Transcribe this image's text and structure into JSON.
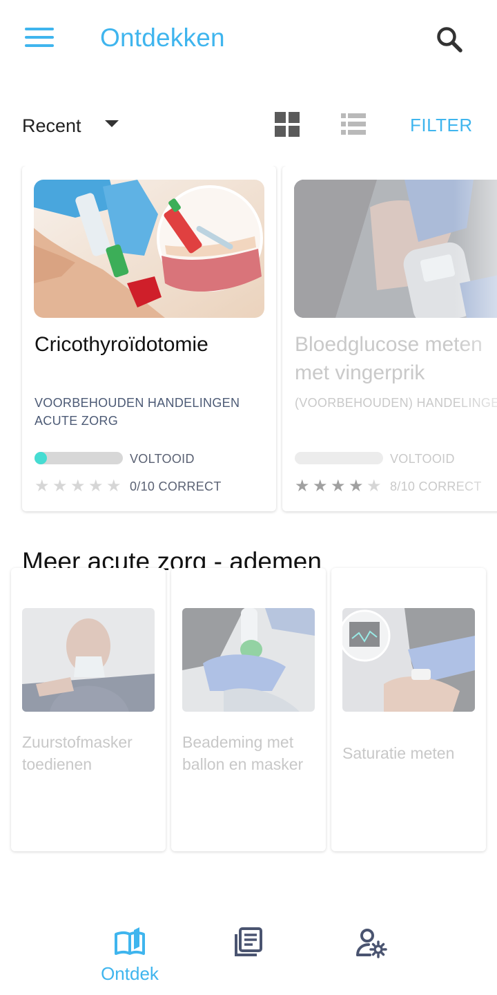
{
  "app_bar": {
    "title": "Ontdekken",
    "menu_icon": "menu-icon",
    "search_icon": "search-icon"
  },
  "toolbar": {
    "sort_value": "Recent",
    "grid_view_icon": "grid-view-icon",
    "list_view_icon": "list-view-icon",
    "filter_label": "FILTER"
  },
  "featured": [
    {
      "title": "Cricothyroïdotomie",
      "category": "VOORBEHOUDEN HANDELINGEN ACUTE ZORG",
      "progress": 0.06,
      "status": "VOLTOOID",
      "stars": 0,
      "score": "0/10 CORRECT"
    },
    {
      "title": "Bloedglucose meten met vingerprik",
      "category": "(VOORBEHOUDEN) HANDELINGEN",
      "progress": 0,
      "status": "VOLTOOID",
      "stars": 4,
      "score": "8/10 CORRECT"
    }
  ],
  "section": {
    "title": "Meer acute zorg - ademen",
    "items": [
      {
        "title": "Zuurstofmasker toedienen"
      },
      {
        "title": "Beademing met ballon en masker"
      },
      {
        "title": "Saturatie meten"
      }
    ]
  },
  "bottom_nav": {
    "items": [
      {
        "label": "Ontdek",
        "icon": "book-open-icon",
        "active": true
      },
      {
        "label": "",
        "icon": "library-icon",
        "active": false
      },
      {
        "label": "",
        "icon": "user-settings-icon",
        "active": false
      }
    ]
  },
  "colors": {
    "accent": "#3fb5ee",
    "progress_fill": "#46dcd2",
    "category_text": "#4c5a75",
    "nav_icon": "#4a5470"
  }
}
